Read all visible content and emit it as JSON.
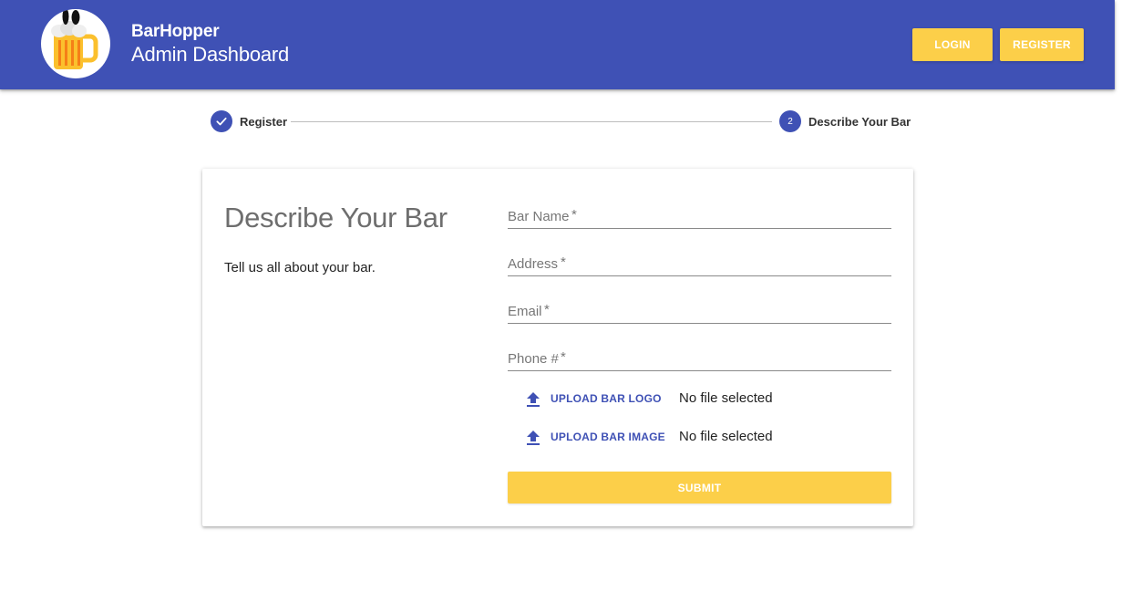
{
  "header": {
    "brand_name": "BarHopper",
    "brand_subtitle": "Admin Dashboard",
    "logo_icon": "beer-mug-icon",
    "login_label": "LOGIN",
    "register_label": "REGISTER",
    "primary_color": "#3f51b5",
    "accent_color": "#fccf49"
  },
  "stepper": {
    "steps": [
      {
        "label": "Register",
        "status": "completed",
        "icon": "check-icon"
      },
      {
        "label": "Describe Your Bar",
        "status": "active",
        "number": "2"
      }
    ]
  },
  "form": {
    "title": "Describe Your Bar",
    "description": "Tell us all about your bar.",
    "fields": [
      {
        "placeholder": "Bar Name",
        "required_mark": "*",
        "value": ""
      },
      {
        "placeholder": "Address",
        "required_mark": "*",
        "value": ""
      },
      {
        "placeholder": "Email",
        "required_mark": "*",
        "value": ""
      },
      {
        "placeholder": "Phone #",
        "required_mark": "*",
        "value": ""
      }
    ],
    "uploads": [
      {
        "label": "UPLOAD BAR LOGO",
        "status": "No file selected",
        "icon": "upload-icon"
      },
      {
        "label": "UPLOAD BAR IMAGE",
        "status": "No file selected",
        "icon": "upload-icon"
      }
    ],
    "submit_label": "SUBMIT"
  }
}
